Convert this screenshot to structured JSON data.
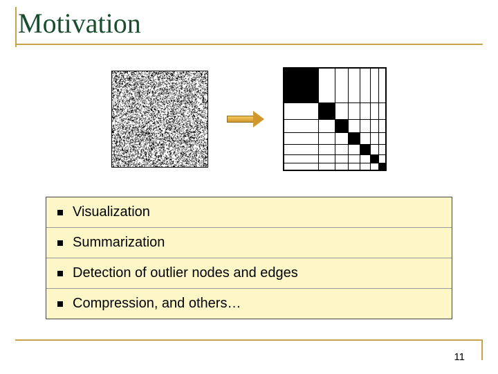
{
  "title": "Motivation",
  "bullets": {
    "b0": "Visualization",
    "b1": "Summarization",
    "b2": "Detection of outlier nodes and edges",
    "b3": "Compression, and others…"
  },
  "page_number": "11",
  "chart_data": {
    "type": "heatmap",
    "title": "",
    "description": "Left: unordered dense adjacency matrix (noise). Right: reordered block-diagonal matrix showing cluster structure.",
    "right_matrix": {
      "size": 150,
      "partition_edges": [
        0,
        50,
        75,
        95,
        112,
        127,
        140,
        150
      ],
      "filled_diagonal_blocks": [
        0,
        1,
        2,
        3,
        4,
        5,
        6
      ]
    }
  }
}
